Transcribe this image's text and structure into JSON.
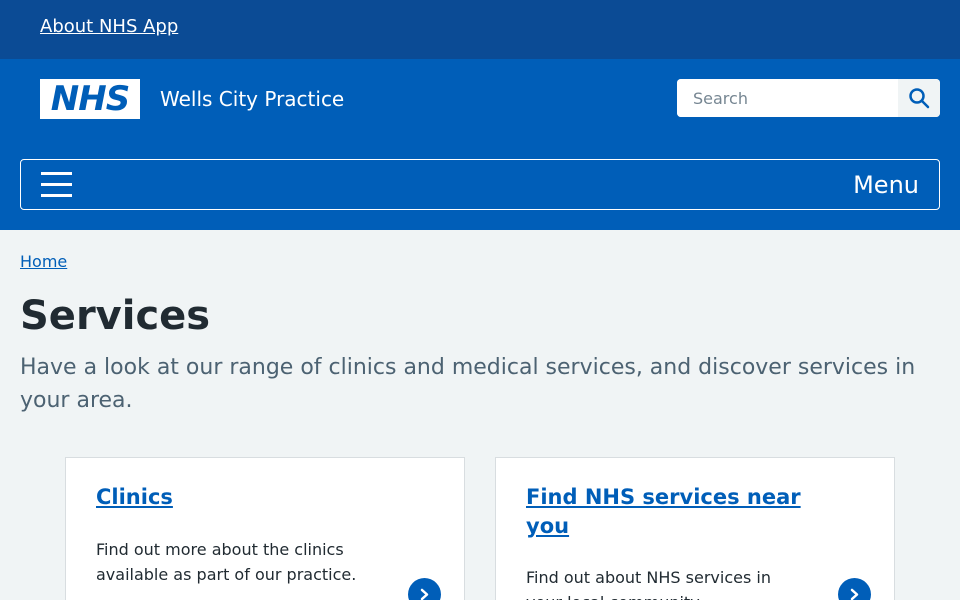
{
  "topbar": {
    "link": "About NHS App"
  },
  "header": {
    "logo_text": "NHS",
    "practice_name": "Wells City Practice",
    "search": {
      "placeholder": "Search",
      "value": ""
    },
    "menu_label": "Menu"
  },
  "breadcrumb": {
    "home": "Home"
  },
  "main": {
    "title": "Services",
    "lede": "Have a look at our range of clinics and medical services, and discover services in your area.",
    "cards": [
      {
        "title": "Clinics",
        "description": "Find out more about the clinics available as part of our practice."
      },
      {
        "title": "Find NHS services near you",
        "description": "Find out about NHS services in your local community."
      }
    ]
  },
  "icons": {
    "search": "search-icon",
    "menu": "hamburger-menu-icon",
    "card_arrow": "chevron-right-circle-icon"
  },
  "colors": {
    "brand_blue": "#005eb8",
    "topbar_blue": "#0b4b95",
    "background": "#f0f4f5"
  }
}
